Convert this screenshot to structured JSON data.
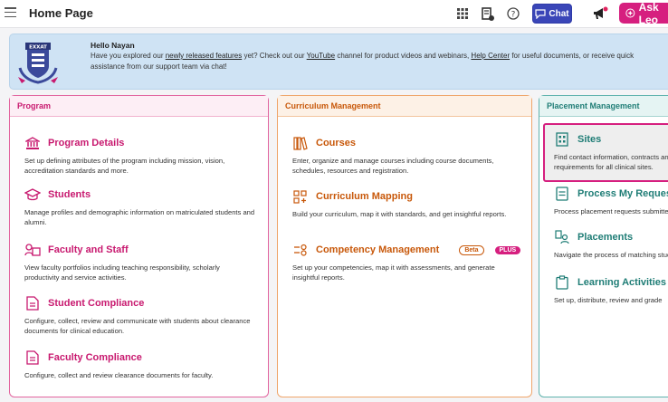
{
  "header": {
    "title": "Home Page",
    "chat_label": "Chat",
    "ask_label": "Ask Leo",
    "icons": [
      "menu-icon",
      "apps-grid-icon",
      "document-icon",
      "help-icon",
      "chat-icon",
      "megaphone-icon",
      "sparkle-icon"
    ]
  },
  "banner": {
    "greeting": "Hello Nayan",
    "msg_part1": "Have you explored our ",
    "link_features": "newly released features",
    "msg_part2": " yet? Check out our ",
    "link_youtube": "YouTube",
    "msg_part3": " channel for product videos and webinars, ",
    "link_help": "Help Center",
    "msg_part4": " for useful documents, or receive quick assistance from our support team via chat!",
    "logo_text": "EXXAT"
  },
  "cards": {
    "program": {
      "heading": "Program",
      "items": [
        {
          "title": "Program Details",
          "desc": "Set up defining attributes of the program including mission, vision, accreditation standards and more."
        },
        {
          "title": "Students",
          "desc": "Manage profiles and demographic information on matriculated students and alumni."
        },
        {
          "title": "Faculty and Staff",
          "desc": "View faculty portfolios including teaching responsibility, scholarly productivity and service activities."
        },
        {
          "title": "Student Compliance",
          "desc": "Configure, collect, review and communicate with students about clearance documents for clinical education."
        },
        {
          "title": "Faculty Compliance",
          "desc": "Configure, collect and review clearance documents for faculty."
        }
      ]
    },
    "curriculum": {
      "heading": "Curriculum Management",
      "items": [
        {
          "title": "Courses",
          "desc": "Enter, organize and manage courses including course documents, schedules, resources and registration."
        },
        {
          "title": "Curriculum Mapping",
          "desc": "Build your curriculum, map it with standards, and get insightful reports."
        },
        {
          "title": "Competency Management",
          "desc": "Set up your competencies, map it with assessments, and generate insightful reports.",
          "badge_beta": "Beta",
          "badge_plus": "PLUS"
        }
      ]
    },
    "placement": {
      "heading": "Placement Management",
      "items": [
        {
          "title": "Sites",
          "desc": "Find contact information, contracts and requirements for all clinical sites."
        },
        {
          "title": "Process My Requests",
          "desc": "Process placement requests submitted"
        },
        {
          "title": "Placements",
          "desc": "Navigate the process of matching students"
        },
        {
          "title": "Learning Activities",
          "desc": "Set up, distribute, review and grade"
        }
      ]
    }
  },
  "colors": {
    "program": "#c8196f",
    "curriculum": "#c8580a",
    "placement": "#1f7d76",
    "ask": "#d61f7f",
    "chat": "#3a46b8"
  }
}
